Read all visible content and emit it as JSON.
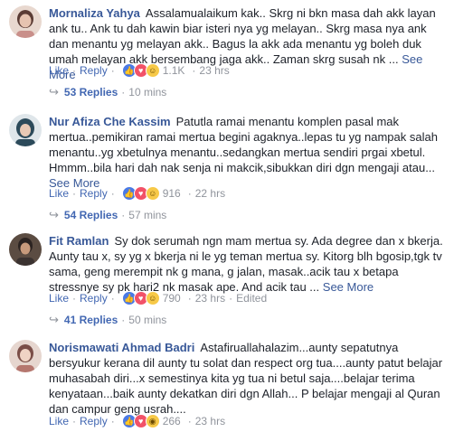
{
  "comments": [
    {
      "author": "Mornaliza Yahya",
      "text": "Assalamualaikum kak.. Skrg ni bkn masa dah akk layan ank tu.. Ank tu dah kawin biar isteri nya yg melayan.. Skrg masa nya ank dan menantu yg melayan akk.. Bagus la akk ada menantu yg boleh duk umah melayan akk bersembang jaga akk.. Zaman skrg susah nk ...",
      "see_more": "See More",
      "like": "Like",
      "reply": "Reply",
      "react_count": "1.1K",
      "time": "23 hrs",
      "replies_label": "53 Replies",
      "replies_time": "10 mins",
      "avatar_colors": [
        "#c9a89a",
        "#5a3b34"
      ]
    },
    {
      "author": "Nur Afiza Che Kassim",
      "text": "Patutla ramai menantu komplen pasal mak mertua..pemikiran ramai mertua begini agaknya..lepas tu yg nampak salah menantu..yg xbetulnya menantu..sedangkan mertua sendiri prgai xbetul. Hmmm..bila hari dah nak senja ni makcik,sibukkan diri dgn mengaji atau...",
      "see_more": "See More",
      "like": "Like",
      "reply": "Reply",
      "react_count": "916",
      "time": "22 hrs",
      "replies_label": "54 Replies",
      "replies_time": "57 mins",
      "avatar_colors": [
        "#d7dfe4",
        "#2c4a5a"
      ]
    },
    {
      "author": "Fit Ramlan",
      "text": "Sy dok serumah ngn mam mertua sy. Ada degree dan x bkerja. Aunty tau x, sy yg x bkerja ni le yg teman mertua sy. Kitorg blh bgosip,tgk tv sama, geng merempit nk g mana, g jalan, masak..acik tau x betapa stressnye sy pk hari2 nk masak ape. And acik tau ...",
      "see_more": "See More",
      "like": "Like",
      "reply": "Reply",
      "react_count": "790",
      "time": "23 hrs",
      "edited": "Edited",
      "replies_label": "41 Replies",
      "replies_time": "50 mins",
      "avatar_colors": [
        "#6e5b4d",
        "#2b2321"
      ]
    },
    {
      "author": "Norismawati Ahmad Badri",
      "text": "Astafiruallahalazim...aunty sepatutnya bersyukur kerana dil aunty tu solat dan respect org tua....aunty patut belajar muhasabah diri...x semestinya kita yg tua ni betul saja....belajar terima kenyataan...baik aunty dekatkan diri dgn Allah... P belajar mengaji al Quran dan campur geng usrah....",
      "see_more": "",
      "like": "Like",
      "reply": "Reply",
      "react_count": "266",
      "time": "23 hrs",
      "avatar_colors": [
        "#d9c7c0",
        "#7a4e48"
      ]
    }
  ],
  "colors": {
    "link": "#385898",
    "action": "#4267b2",
    "muted": "#90949c"
  }
}
